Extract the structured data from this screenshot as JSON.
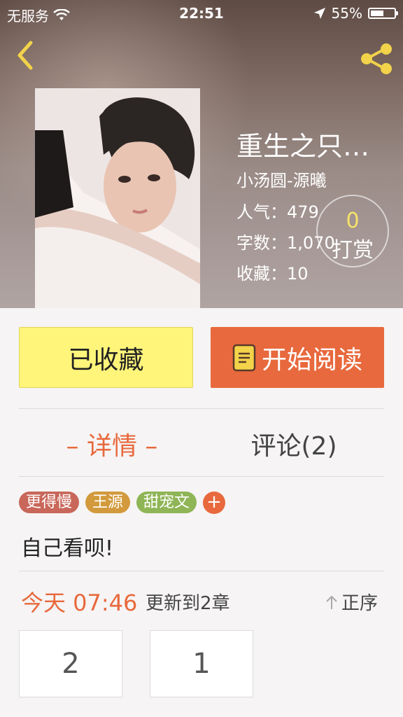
{
  "status_bar": {
    "carrier": "无服务",
    "time": "22:51",
    "battery": "55%",
    "battery_level": 0.55
  },
  "header": {
    "back_icon": "chevron-left-icon",
    "share_icon": "share-icon",
    "accent_color": "#f2d34a"
  },
  "book": {
    "title": "重生之只…",
    "author": "小汤圆-源曦",
    "popularity_label": "人气：",
    "popularity": "479",
    "words_label": "字数：",
    "words": "1,070",
    "favorites_label": "收藏：",
    "favorites": "10",
    "tip_count": "0",
    "tip_label": "打赏"
  },
  "actions": {
    "favorite_label": "已收藏",
    "read_label": "开始阅读",
    "favorite_color": "#fff57a",
    "read_color": "#e8693d"
  },
  "tabs": {
    "detail": "– 详情 –",
    "comments": "评论(2)"
  },
  "tags": [
    {
      "label": "更得慢",
      "color": "#c8675a"
    },
    {
      "label": "王源",
      "color": "#d29a3c"
    },
    {
      "label": "甜宠文",
      "color": "#8fb556"
    }
  ],
  "tag_add": "+",
  "summary": "自己看呗!",
  "update": {
    "time": "今天 07:46",
    "text": "更新到2章",
    "order": "正序"
  },
  "chapters": [
    "2",
    "1"
  ]
}
